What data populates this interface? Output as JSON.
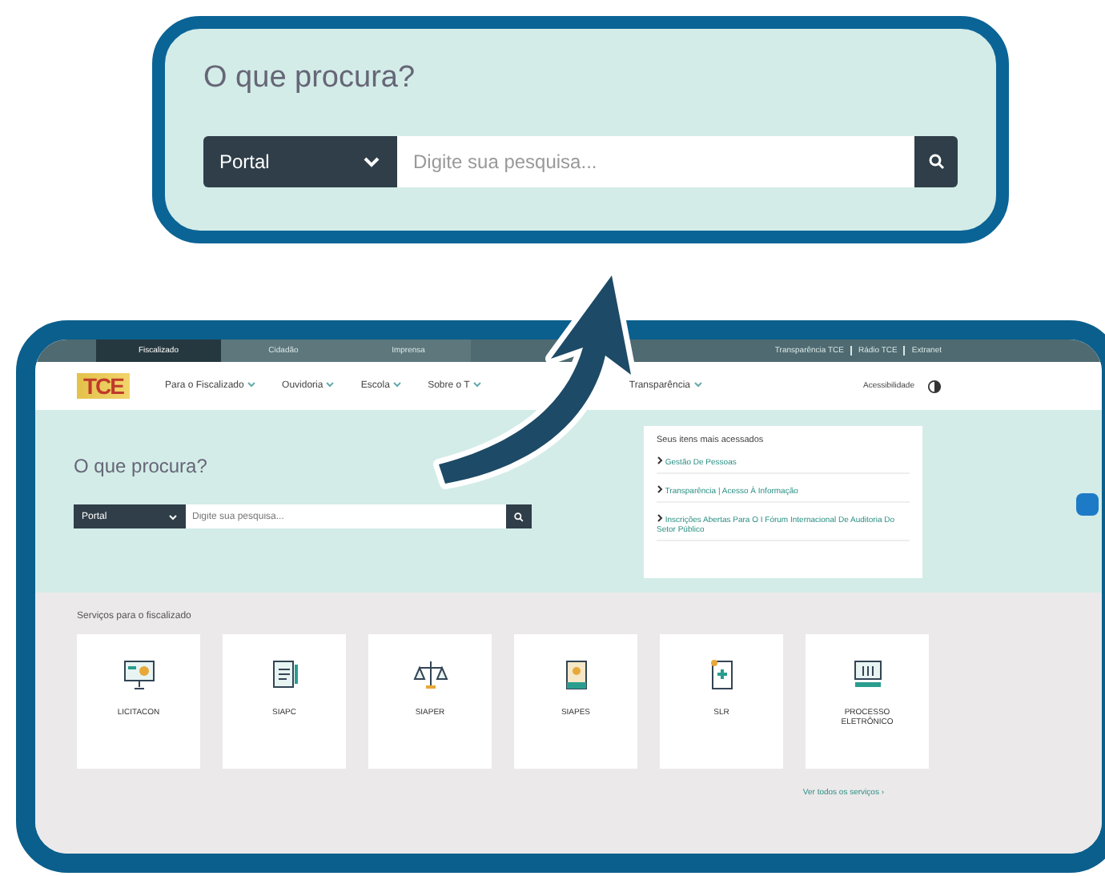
{
  "callout": {
    "heading": "O que procura?",
    "scope": "Portal",
    "placeholder": "Digite sua pesquisa..."
  },
  "site": {
    "top_tabs": [
      {
        "label": "Fiscalizado",
        "selected": true
      },
      {
        "label": "Cidadão",
        "selected": false
      },
      {
        "label": "Imprensa",
        "selected": false
      }
    ],
    "top_links": [
      "Transparência TCE",
      "Rádio TCE",
      "Extranet"
    ],
    "logo": "TCE",
    "nav": [
      "Para o Fiscalizado",
      "Ouvidoria",
      "Escola",
      "Sobre o T",
      "Transparência"
    ],
    "accessibility": "Acessibilidade",
    "hero": {
      "heading": "O que procura?",
      "scope": "Portal",
      "placeholder": "Digite sua pesquisa..."
    },
    "most_accessed": {
      "title": "Seus itens mais acessados",
      "items": [
        "Gestão De Pessoas",
        "Transparência | Acesso À Informação",
        "Inscrições Abertas Para O I Fórum Internacional De Auditoria Do Setor Público"
      ]
    },
    "services": {
      "title": "Serviços para o fiscalizado",
      "items": [
        {
          "label": "LICITACON",
          "kind": "presentation"
        },
        {
          "label": "SIAPC",
          "kind": "clipboard"
        },
        {
          "label": "SIAPER",
          "kind": "scales"
        },
        {
          "label": "SIAPES",
          "kind": "badge"
        },
        {
          "label": "SLR",
          "kind": "document"
        },
        {
          "label": "PROCESSO ELETRÔNICO",
          "kind": "computer"
        }
      ],
      "more_link": "Ver todos os serviços ›"
    }
  }
}
